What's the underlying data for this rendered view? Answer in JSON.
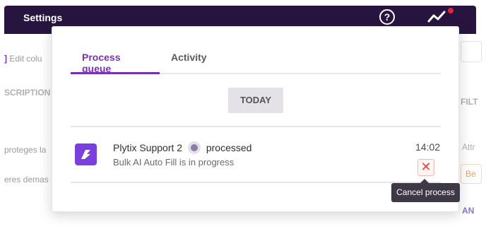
{
  "topbar": {
    "title": "Settings",
    "help_glyph": "?"
  },
  "background": {
    "edit_columns": "Edit colu",
    "description_header": "SCRIPTION",
    "row1": "proteges la",
    "row2": "eres demas",
    "right_header": "FILT",
    "right_cell1": "Attr",
    "right_chip": "Be",
    "right_bottom": "AN"
  },
  "modal": {
    "tabs": [
      {
        "label": "Process queue",
        "active": true
      },
      {
        "label": "Activity",
        "active": false
      }
    ],
    "date_group": "TODAY",
    "items": [
      {
        "user": "Plytix Support 2",
        "action": "processed",
        "description": "Bulk AI Auto Fill is in progress",
        "time": "14:02",
        "cancel_glyph": "✕"
      }
    ],
    "tooltip": "Cancel process"
  },
  "colors": {
    "brand": "#27153f",
    "accent": "#7a2fb3",
    "danger": "#e0443f"
  }
}
